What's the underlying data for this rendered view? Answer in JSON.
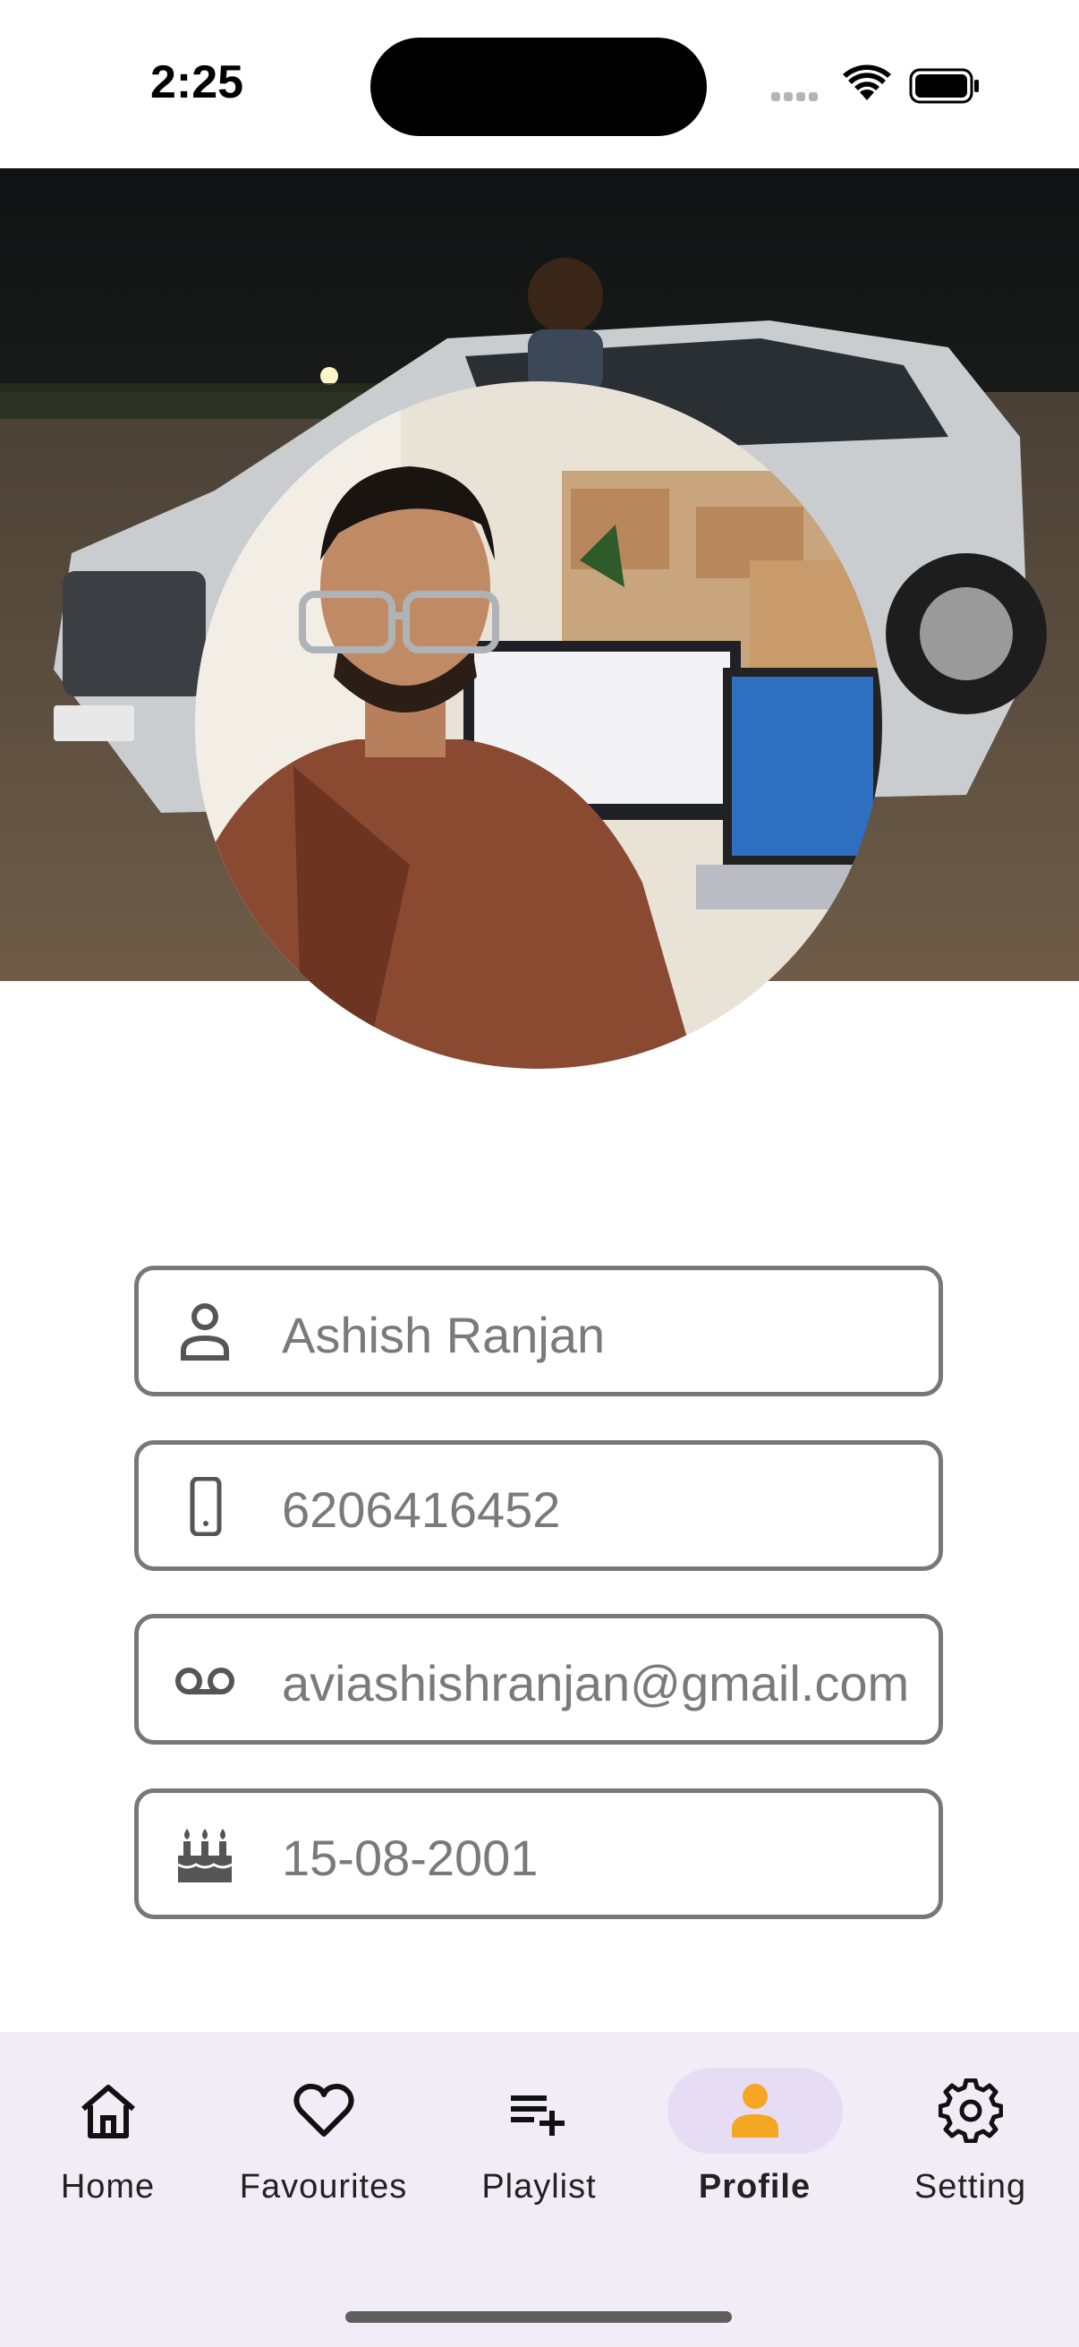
{
  "status_bar": {
    "time": "2:25"
  },
  "profile": {
    "name": "Ashish Ranjan",
    "phone": "6206416452",
    "email": "aviashishranjan@gmail.com",
    "dob": "15-08-2001"
  },
  "icons": {
    "name": "person-outline-icon",
    "phone": "phone-outline-icon",
    "email": "voicemail-icon",
    "dob": "cake-icon"
  },
  "nav": {
    "items": [
      {
        "label": "Home",
        "icon": "home-icon"
      },
      {
        "label": "Favourites",
        "icon": "heart-icon"
      },
      {
        "label": "Playlist",
        "icon": "playlist-add-icon"
      },
      {
        "label": "Profile",
        "icon": "person-icon",
        "active": true
      },
      {
        "label": "Setting",
        "icon": "gear-icon"
      }
    ]
  },
  "colors": {
    "accent": "#F5A623",
    "nav_background": "#F1EDF6",
    "active_pill": "#E6DDF5",
    "field_border": "#777777",
    "field_text": "#7A7A7A"
  }
}
